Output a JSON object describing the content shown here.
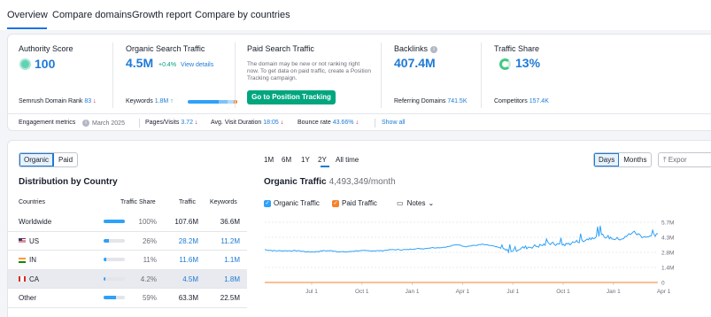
{
  "tabs": [
    "Overview",
    "Compare domains",
    "Growth report",
    "Compare by countries"
  ],
  "authority": {
    "title": "Authority Score",
    "value": "100",
    "rank_label": "Semrush Domain Rank",
    "rank_value": "83",
    "rank_trend": "↓"
  },
  "organic": {
    "title": "Organic Search Traffic",
    "value": "4.5M",
    "change": "+0.4%",
    "details": "View details",
    "keywords_label": "Keywords",
    "keywords_value": "1.8M",
    "keywords_trend": "↑"
  },
  "paid": {
    "title": "Paid Search Traffic",
    "description": "The domain may be new or not ranking right now. To get data on paid traffic, create a Position Tracking campaign.",
    "button": "Go to Position Tracking"
  },
  "backlinks": {
    "title": "Backlinks",
    "value": "407.4M",
    "ref_label": "Referring Domains",
    "ref_value": "741.5K"
  },
  "traffic_share": {
    "title": "Traffic Share",
    "value": "13%",
    "competitors_label": "Competitors",
    "competitors_value": "157.4K"
  },
  "engagement": {
    "label": "Engagement metrics",
    "date": "March 2025",
    "pages_label": "Pages/Visits",
    "pages_value": "3.72",
    "pages_trend": "↓",
    "duration_label": "Avg. Visit Duration",
    "duration_value": "18:05",
    "duration_trend": "↓",
    "bounce_label": "Bounce rate",
    "bounce_value": "43.66%",
    "bounce_trend": "↓",
    "show_all": "Show all"
  },
  "toggle": {
    "organic": "Organic",
    "paid": "Paid"
  },
  "distribution": {
    "title": "Distribution by Country",
    "headers": {
      "countries": "Countries",
      "share": "Traffic Share",
      "traffic": "Traffic",
      "keywords": "Keywords"
    },
    "rows": [
      {
        "country": "Worldwide",
        "share": "100%",
        "share_value": 1.0,
        "traffic": "107.6M",
        "keywords": "36.6M"
      },
      {
        "country": "US",
        "share": "26%",
        "share_value": 0.26,
        "traffic": "28.2M",
        "keywords": "11.2M"
      },
      {
        "country": "IN",
        "share": "11%",
        "share_value": 0.11,
        "traffic": "11.6M",
        "keywords": "1.1M"
      },
      {
        "country": "CA",
        "share": "4.2%",
        "share_value": 0.042,
        "traffic": "4.5M",
        "keywords": "1.8M"
      },
      {
        "country": "Other",
        "share": "59%",
        "share_value": 0.59,
        "traffic": "63.3M",
        "keywords": "22.5M"
      }
    ]
  },
  "periods": [
    "1M",
    "6M",
    "1Y",
    "2Y",
    "All time"
  ],
  "granularity": {
    "days": "Days",
    "months": "Months"
  },
  "export_label": "Expor",
  "organic_chart": {
    "title": "Organic Traffic",
    "subtitle": "4,493,349/month",
    "organic_legend": "Organic Traffic",
    "paid_legend": "Paid Traffic",
    "notes": "Notes"
  },
  "colors": {
    "accent": "#1e7ad6",
    "organic_line": "#2ea1f8",
    "paid_line": "#f5822c",
    "button": "#00a67e"
  },
  "chart_data": {
    "type": "line",
    "x_ticks": [
      "Jul 1",
      "Oct 1",
      "Jan 1",
      "Apr 1",
      "Jul 1",
      "Oct 1",
      "Jan 1",
      "Apr 1"
    ],
    "y_ticks": [
      "5.7M",
      "4.3M",
      "2.8M",
      "1.4M",
      "0"
    ],
    "ylim": [
      0,
      5700000
    ],
    "series": [
      {
        "name": "Organic Traffic",
        "values": [
          3.1,
          3.0,
          3.0,
          3.0,
          3.0,
          2.9,
          2.9,
          3.0,
          3.0,
          2.9,
          2.9,
          3.0,
          3.0,
          3.0,
          3.0,
          3.1,
          3.1,
          3.1,
          3.2,
          3.2,
          3.3,
          3.3,
          3.4,
          3.6,
          3.4,
          3.5,
          3.6,
          3.5,
          3.3,
          3.0,
          3.1,
          3.3,
          3.4,
          3.5,
          3.7,
          3.6,
          3.6,
          3.8,
          4.0,
          4.2,
          4.5,
          4.3,
          4.1,
          4.2,
          4.8,
          4.4,
          4.3,
          4.5
        ]
      },
      {
        "name": "Paid Traffic",
        "values": [
          0,
          0,
          0,
          0,
          0,
          0,
          0,
          0,
          0,
          0,
          0,
          0,
          0,
          0,
          0,
          0,
          0,
          0,
          0,
          0,
          0,
          0,
          0,
          0,
          0,
          0,
          0,
          0,
          0,
          0,
          0,
          0,
          0,
          0,
          0,
          0,
          0,
          0,
          0,
          0,
          0,
          0,
          0,
          0,
          0,
          0,
          0,
          0
        ]
      }
    ]
  }
}
